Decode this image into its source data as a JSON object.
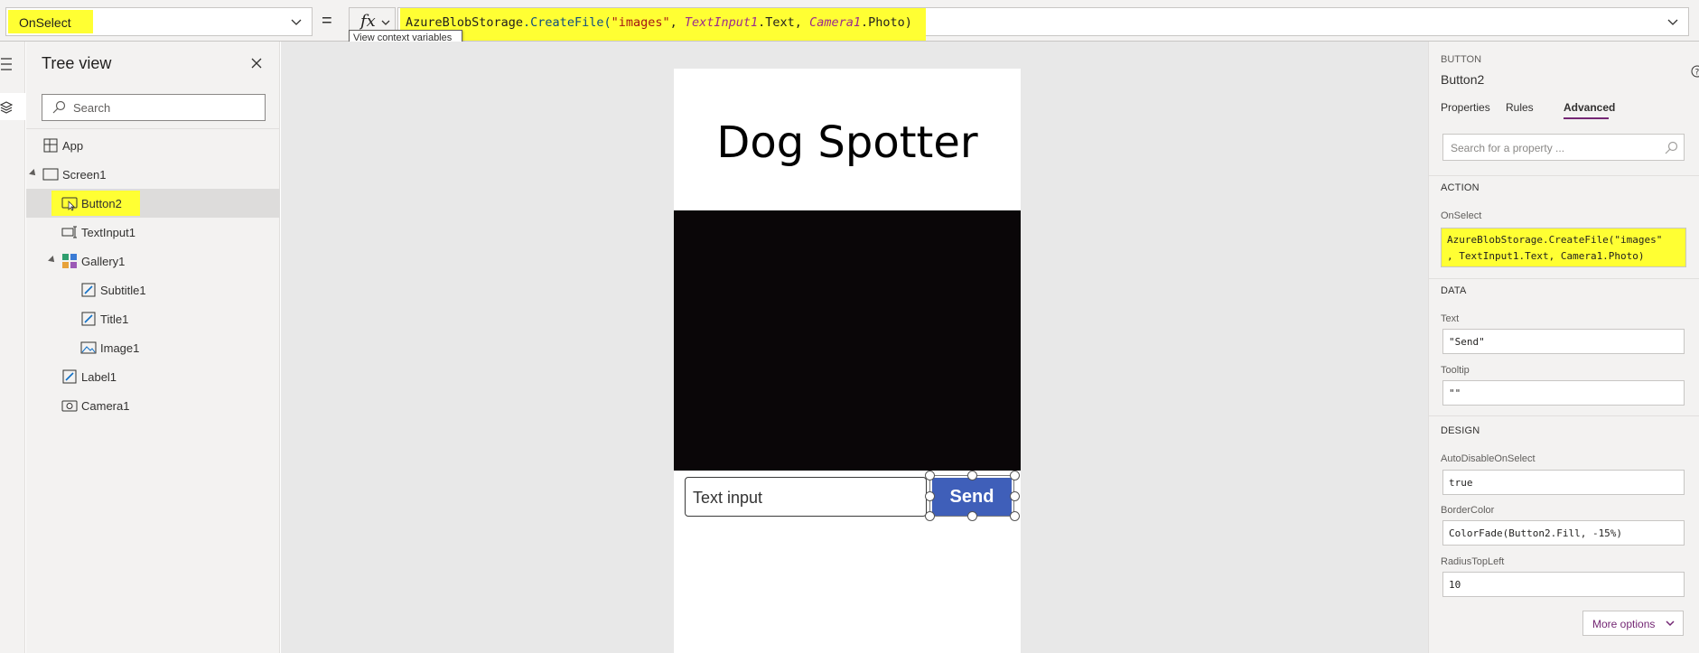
{
  "formula_bar": {
    "property": "OnSelect",
    "equals": "=",
    "fx_label": "fx",
    "formula_tokens": [
      {
        "text": "AzureBlobStorage",
        "kind": "plain"
      },
      {
        "text": ".CreateFile(",
        "kind": "fn"
      },
      {
        "text": "\"images\"",
        "kind": "str"
      },
      {
        "text": ", ",
        "kind": "plain"
      },
      {
        "text": "TextInput1",
        "kind": "ctrl"
      },
      {
        "text": ".Text, ",
        "kind": "plain"
      },
      {
        "text": "Camera1",
        "kind": "ctrl"
      },
      {
        "text": ".Photo)",
        "kind": "plain"
      }
    ],
    "tooltip": "View context variables"
  },
  "tree_view": {
    "title": "Tree view",
    "search_placeholder": "Search",
    "nodes": [
      {
        "label": "App",
        "icon": "app-icon",
        "depth": 0,
        "caret": false,
        "selected": false
      },
      {
        "label": "Screen1",
        "icon": "screen-icon",
        "depth": 0,
        "caret": true,
        "selected": false
      },
      {
        "label": "Button2",
        "icon": "button-icon",
        "depth": 1,
        "caret": false,
        "selected": true
      },
      {
        "label": "TextInput1",
        "icon": "text-input-icon",
        "depth": 1,
        "caret": false,
        "selected": false
      },
      {
        "label": "Gallery1",
        "icon": "gallery-icon",
        "depth": 1,
        "caret": true,
        "selected": false
      },
      {
        "label": "Subtitle1",
        "icon": "label-icon",
        "depth": 2,
        "caret": false,
        "selected": false
      },
      {
        "label": "Title1",
        "icon": "label-icon",
        "depth": 2,
        "caret": false,
        "selected": false
      },
      {
        "label": "Image1",
        "icon": "image-icon",
        "depth": 2,
        "caret": false,
        "selected": false
      },
      {
        "label": "Label1",
        "icon": "label-icon",
        "depth": 1,
        "caret": false,
        "selected": false
      },
      {
        "label": "Camera1",
        "icon": "camera-icon",
        "depth": 1,
        "caret": false,
        "selected": false
      }
    ]
  },
  "canvas": {
    "app_title": "Dog Spotter",
    "text_input_value": "Text input",
    "send_button_label": "Send"
  },
  "properties": {
    "control_type": "BUTTON",
    "control_name": "Button2",
    "tabs": [
      {
        "label": "Properties",
        "active": false
      },
      {
        "label": "Rules",
        "active": false
      },
      {
        "label": "Advanced",
        "active": true
      }
    ],
    "search_placeholder": "Search for a property ...",
    "action": {
      "heading": "ACTION",
      "onselect_label": "OnSelect",
      "onselect_line1": "AzureBlobStorage.CreateFile(\"images\"",
      "onselect_line2": ", TextInput1.Text, Camera1.Photo)"
    },
    "data": {
      "heading": "DATA",
      "text_label": "Text",
      "text_value": "\"Send\"",
      "tooltip_label": "Tooltip",
      "tooltip_value": "\"\""
    },
    "design": {
      "heading": "DESIGN",
      "autodisable_label": "AutoDisableOnSelect",
      "autodisable_value": "true",
      "bordercolor_label": "BorderColor",
      "bordercolor_value": "ColorFade(Button2.Fill, -15%)",
      "radius_label": "RadiusTopLeft",
      "radius_value": "10"
    },
    "more_options": "More options"
  },
  "colors": {
    "highlight": "#ffff33",
    "accent_purple": "#742774",
    "send_button": "#3f5fb9",
    "camera_feed": "#0a0608"
  }
}
